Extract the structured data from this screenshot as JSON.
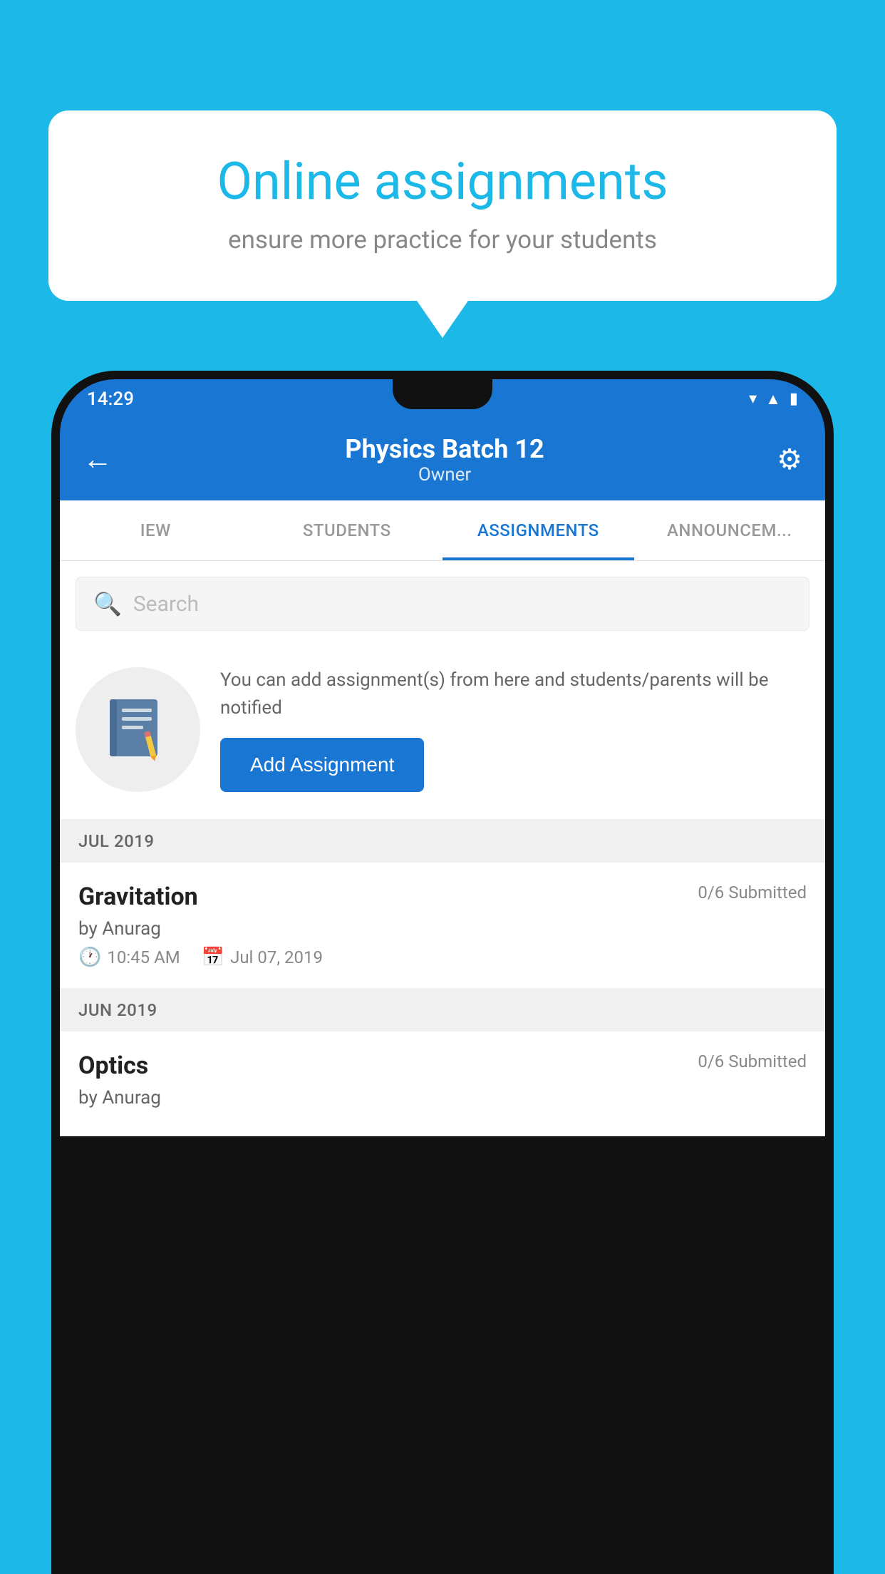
{
  "background_color": "#1bb8e8",
  "speech_bubble": {
    "title": "Online assignments",
    "subtitle": "ensure more practice for your students"
  },
  "status_bar": {
    "time": "14:29",
    "icons": [
      "wifi",
      "signal",
      "battery"
    ]
  },
  "app_bar": {
    "title": "Physics Batch 12",
    "subtitle": "Owner",
    "back_label": "←",
    "settings_label": "⚙"
  },
  "tabs": [
    {
      "label": "IEW",
      "active": false
    },
    {
      "label": "STUDENTS",
      "active": false
    },
    {
      "label": "ASSIGNMENTS",
      "active": true
    },
    {
      "label": "ANNOUNCEM...",
      "active": false
    }
  ],
  "search": {
    "placeholder": "Search"
  },
  "promo": {
    "description": "You can add assignment(s) from here and students/parents will be notified",
    "button_label": "Add Assignment"
  },
  "sections": [
    {
      "label": "JUL 2019",
      "assignments": [
        {
          "name": "Gravitation",
          "submitted": "0/6 Submitted",
          "by": "by Anurag",
          "time": "10:45 AM",
          "date": "Jul 07, 2019"
        }
      ]
    },
    {
      "label": "JUN 2019",
      "assignments": [
        {
          "name": "Optics",
          "submitted": "0/6 Submitted",
          "by": "by Anurag",
          "time": "",
          "date": ""
        }
      ]
    }
  ]
}
